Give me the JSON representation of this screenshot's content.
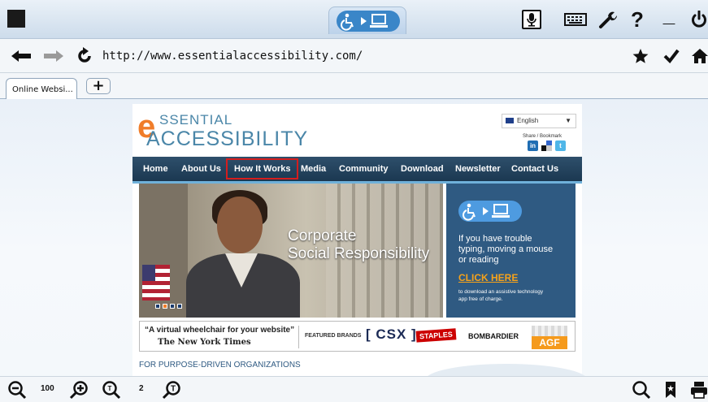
{
  "toolbar": {
    "icons": [
      "stop-square-icon",
      "accessibility-logo-icon",
      "microphone-icon",
      "keyboard-icon",
      "wrench-icon",
      "help-icon",
      "minimize-icon",
      "power-icon"
    ],
    "help_glyph": "?",
    "minimize_glyph": "_"
  },
  "navigation": {
    "url": "http://www.essentialaccessibility.com/"
  },
  "tabs": {
    "active_label": "Online Websi...",
    "new_tab_glyph": "+"
  },
  "site": {
    "logo": {
      "letter": "e",
      "top": "SSENTIAL",
      "bottom": "ACCESSIBILITY"
    },
    "language": "English",
    "share_label": "Share / Bookmark",
    "social": [
      "in",
      "",
      "t"
    ],
    "menu": [
      "Home",
      "About Us",
      "How It Works",
      "Media",
      "Community",
      "Download",
      "Newsletter",
      "Contact Us"
    ],
    "active_menu": "How It Works",
    "hero": {
      "line1": "Corporate",
      "line2": "Social Responsibility",
      "slide_count": 4,
      "active_slide": 1
    },
    "promo": {
      "lines": [
        "If you have trouble",
        "typing, moving a mouse",
        "or reading"
      ],
      "cta": "CLICK HERE",
      "small": [
        "to download an assistive technology",
        "app free of charge."
      ]
    },
    "brands": {
      "quote": "“A virtual wheelchair for your website”",
      "source": "The New York Times",
      "featured": "FEATURED BRANDS",
      "csx": "[ CSX ]",
      "staples": "STAPLES",
      "bombardier": "BOMBARDIER",
      "agf": "AGF"
    },
    "section_heading": "FOR PURPOSE-DRIVEN ORGANIZATIONS"
  },
  "bottom": {
    "zoom_value": "100",
    "page_value": "2"
  },
  "colors": {
    "brand_orange": "#f07d2a",
    "brand_blue": "#4a86a8",
    "menu_dark": "#1b3851",
    "active_outline": "#d51d1d",
    "promo_blue": "#2f5a82"
  }
}
